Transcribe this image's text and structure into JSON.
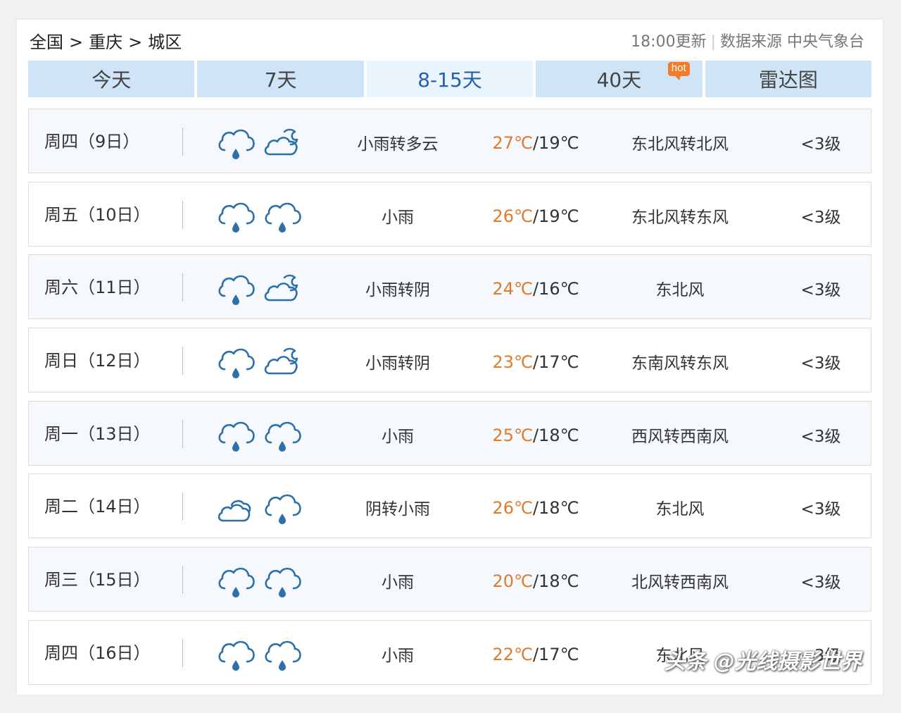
{
  "breadcrumb": {
    "country": "全国",
    "separator": ">",
    "city": "重庆",
    "district": "城区"
  },
  "source": {
    "update_time": "18:00更新",
    "divider": "|",
    "label": "数据来源 中央气象台"
  },
  "tabs": [
    {
      "label": "今天",
      "active": false
    },
    {
      "label": "7天",
      "active": false
    },
    {
      "label": "8-15天",
      "active": true
    },
    {
      "label": "40天",
      "active": false,
      "badge": "hot"
    },
    {
      "label": "雷达图",
      "active": false
    }
  ],
  "colors": {
    "tab_bg": "#cfe4f6",
    "tab_active_text": "#2460b0",
    "high_temp": "#e07b2e",
    "icon_stroke": "#2d6fa8",
    "hot_badge": "#f47b2a"
  },
  "forecast": [
    {
      "date": "周四（9日）",
      "day_icon": "rain-icon",
      "night_icon": "cloudy-night-icon",
      "desc": "小雨转多云",
      "high": "27℃",
      "low": "19℃",
      "wind": "东北风转北风",
      "level": "<3级"
    },
    {
      "date": "周五（10日）",
      "day_icon": "rain-icon",
      "night_icon": "rain-icon",
      "desc": "小雨",
      "high": "26℃",
      "low": "19℃",
      "wind": "东北风转东风",
      "level": "<3级"
    },
    {
      "date": "周六（11日）",
      "day_icon": "rain-icon",
      "night_icon": "cloudy-night-icon",
      "desc": "小雨转阴",
      "high": "24℃",
      "low": "16℃",
      "wind": "东北风",
      "level": "<3级"
    },
    {
      "date": "周日（12日）",
      "day_icon": "rain-icon",
      "night_icon": "cloudy-night-icon",
      "desc": "小雨转阴",
      "high": "23℃",
      "low": "17℃",
      "wind": "东南风转东风",
      "level": "<3级"
    },
    {
      "date": "周一（13日）",
      "day_icon": "rain-icon",
      "night_icon": "rain-icon",
      "desc": "小雨",
      "high": "25℃",
      "low": "18℃",
      "wind": "西风转西南风",
      "level": "<3级"
    },
    {
      "date": "周二（14日）",
      "day_icon": "overcast-icon",
      "night_icon": "rain-icon",
      "desc": "阴转小雨",
      "high": "26℃",
      "low": "18℃",
      "wind": "东北风",
      "level": "<3级"
    },
    {
      "date": "周三（15日）",
      "day_icon": "rain-icon",
      "night_icon": "rain-icon",
      "desc": "小雨",
      "high": "20℃",
      "low": "18℃",
      "wind": "北风转西南风",
      "level": "<3级"
    },
    {
      "date": "周四（16日）",
      "day_icon": "rain-icon",
      "night_icon": "rain-icon",
      "desc": "小雨",
      "high": "22℃",
      "low": "17℃",
      "wind": "东北风",
      "level": "<3级"
    }
  ],
  "watermark": "头条 @光线摄影世界"
}
